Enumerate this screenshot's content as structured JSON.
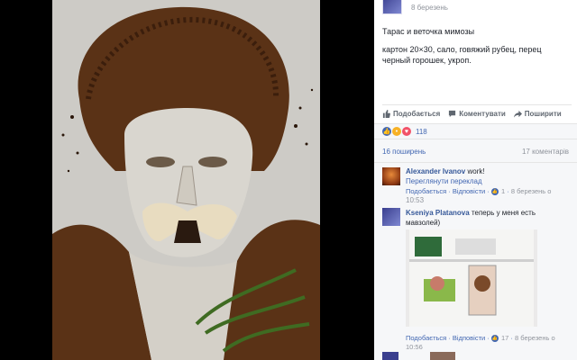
{
  "post": {
    "date": "8 березень",
    "title": "Тарас и веточка мимозы",
    "materials_line1": "картон 20×30, сало, говяжий рубец, перец",
    "materials_line2": "черный горошек, укроп."
  },
  "actions": {
    "like": "Подобається",
    "comment": "Коментувати",
    "share": "Поширити"
  },
  "reactions": {
    "count": "118",
    "colors": {
      "like": "#4267b2",
      "wow": "#f7b125",
      "love": "#f25268"
    }
  },
  "stats": {
    "shares": "16 поширень",
    "comments": "17 коментарів"
  },
  "comments": [
    {
      "author": "Alexander Ivanov",
      "text": "work!",
      "translate": "Переглянути переклад",
      "like": "Подобається",
      "reply": "Відповісти",
      "likes": "1",
      "date": "8 березень о",
      "time": "10:53"
    },
    {
      "author": "Kseniya Platanova",
      "text": "теперь у меня есть",
      "text2": "мавзолей)",
      "like": "Подобається",
      "reply": "Відповісти",
      "likes": "17",
      "date": "8 березень о",
      "time": "10:56"
    }
  ]
}
